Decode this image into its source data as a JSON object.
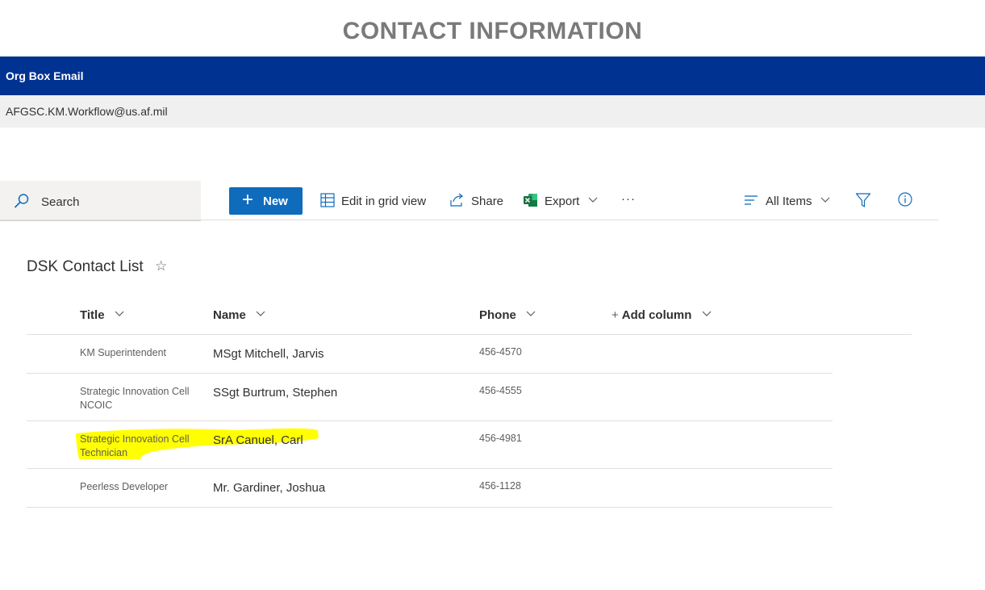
{
  "page_title": "CONTACT INFORMATION",
  "org_box": {
    "header": "Org Box Email",
    "email": "AFGSC.KM.Workflow@us.af.mil"
  },
  "commandbar": {
    "search_placeholder": "Search",
    "new_label": "New",
    "edit_grid_label": "Edit in grid view",
    "share_label": "Share",
    "export_label": "Export",
    "more_label": "···",
    "view_label": "All Items"
  },
  "list": {
    "title": "DSK Contact List",
    "columns": {
      "title": "Title",
      "name": "Name",
      "phone": "Phone",
      "add_column": "Add column"
    },
    "rows": [
      {
        "title": "KM Superintendent",
        "name": "MSgt Mitchell, Jarvis",
        "phone": "456-4570"
      },
      {
        "title": "Strategic Innovation Cell NCOIC",
        "name": "SSgt Burtrum, Stephen",
        "phone": "456-4555"
      },
      {
        "title": "Strategic Innovation Cell Technician",
        "name": "SrA Canuel, Carl",
        "phone": "456-4981"
      },
      {
        "title": "Peerless Developer",
        "name": "Mr. Gardiner, Joshua",
        "phone": "456-1128"
      }
    ]
  },
  "colors": {
    "header_blue": "#003391",
    "accent": "#0f6cbd",
    "highlight": "#ffff00",
    "excel_green": "#1d6f42"
  }
}
